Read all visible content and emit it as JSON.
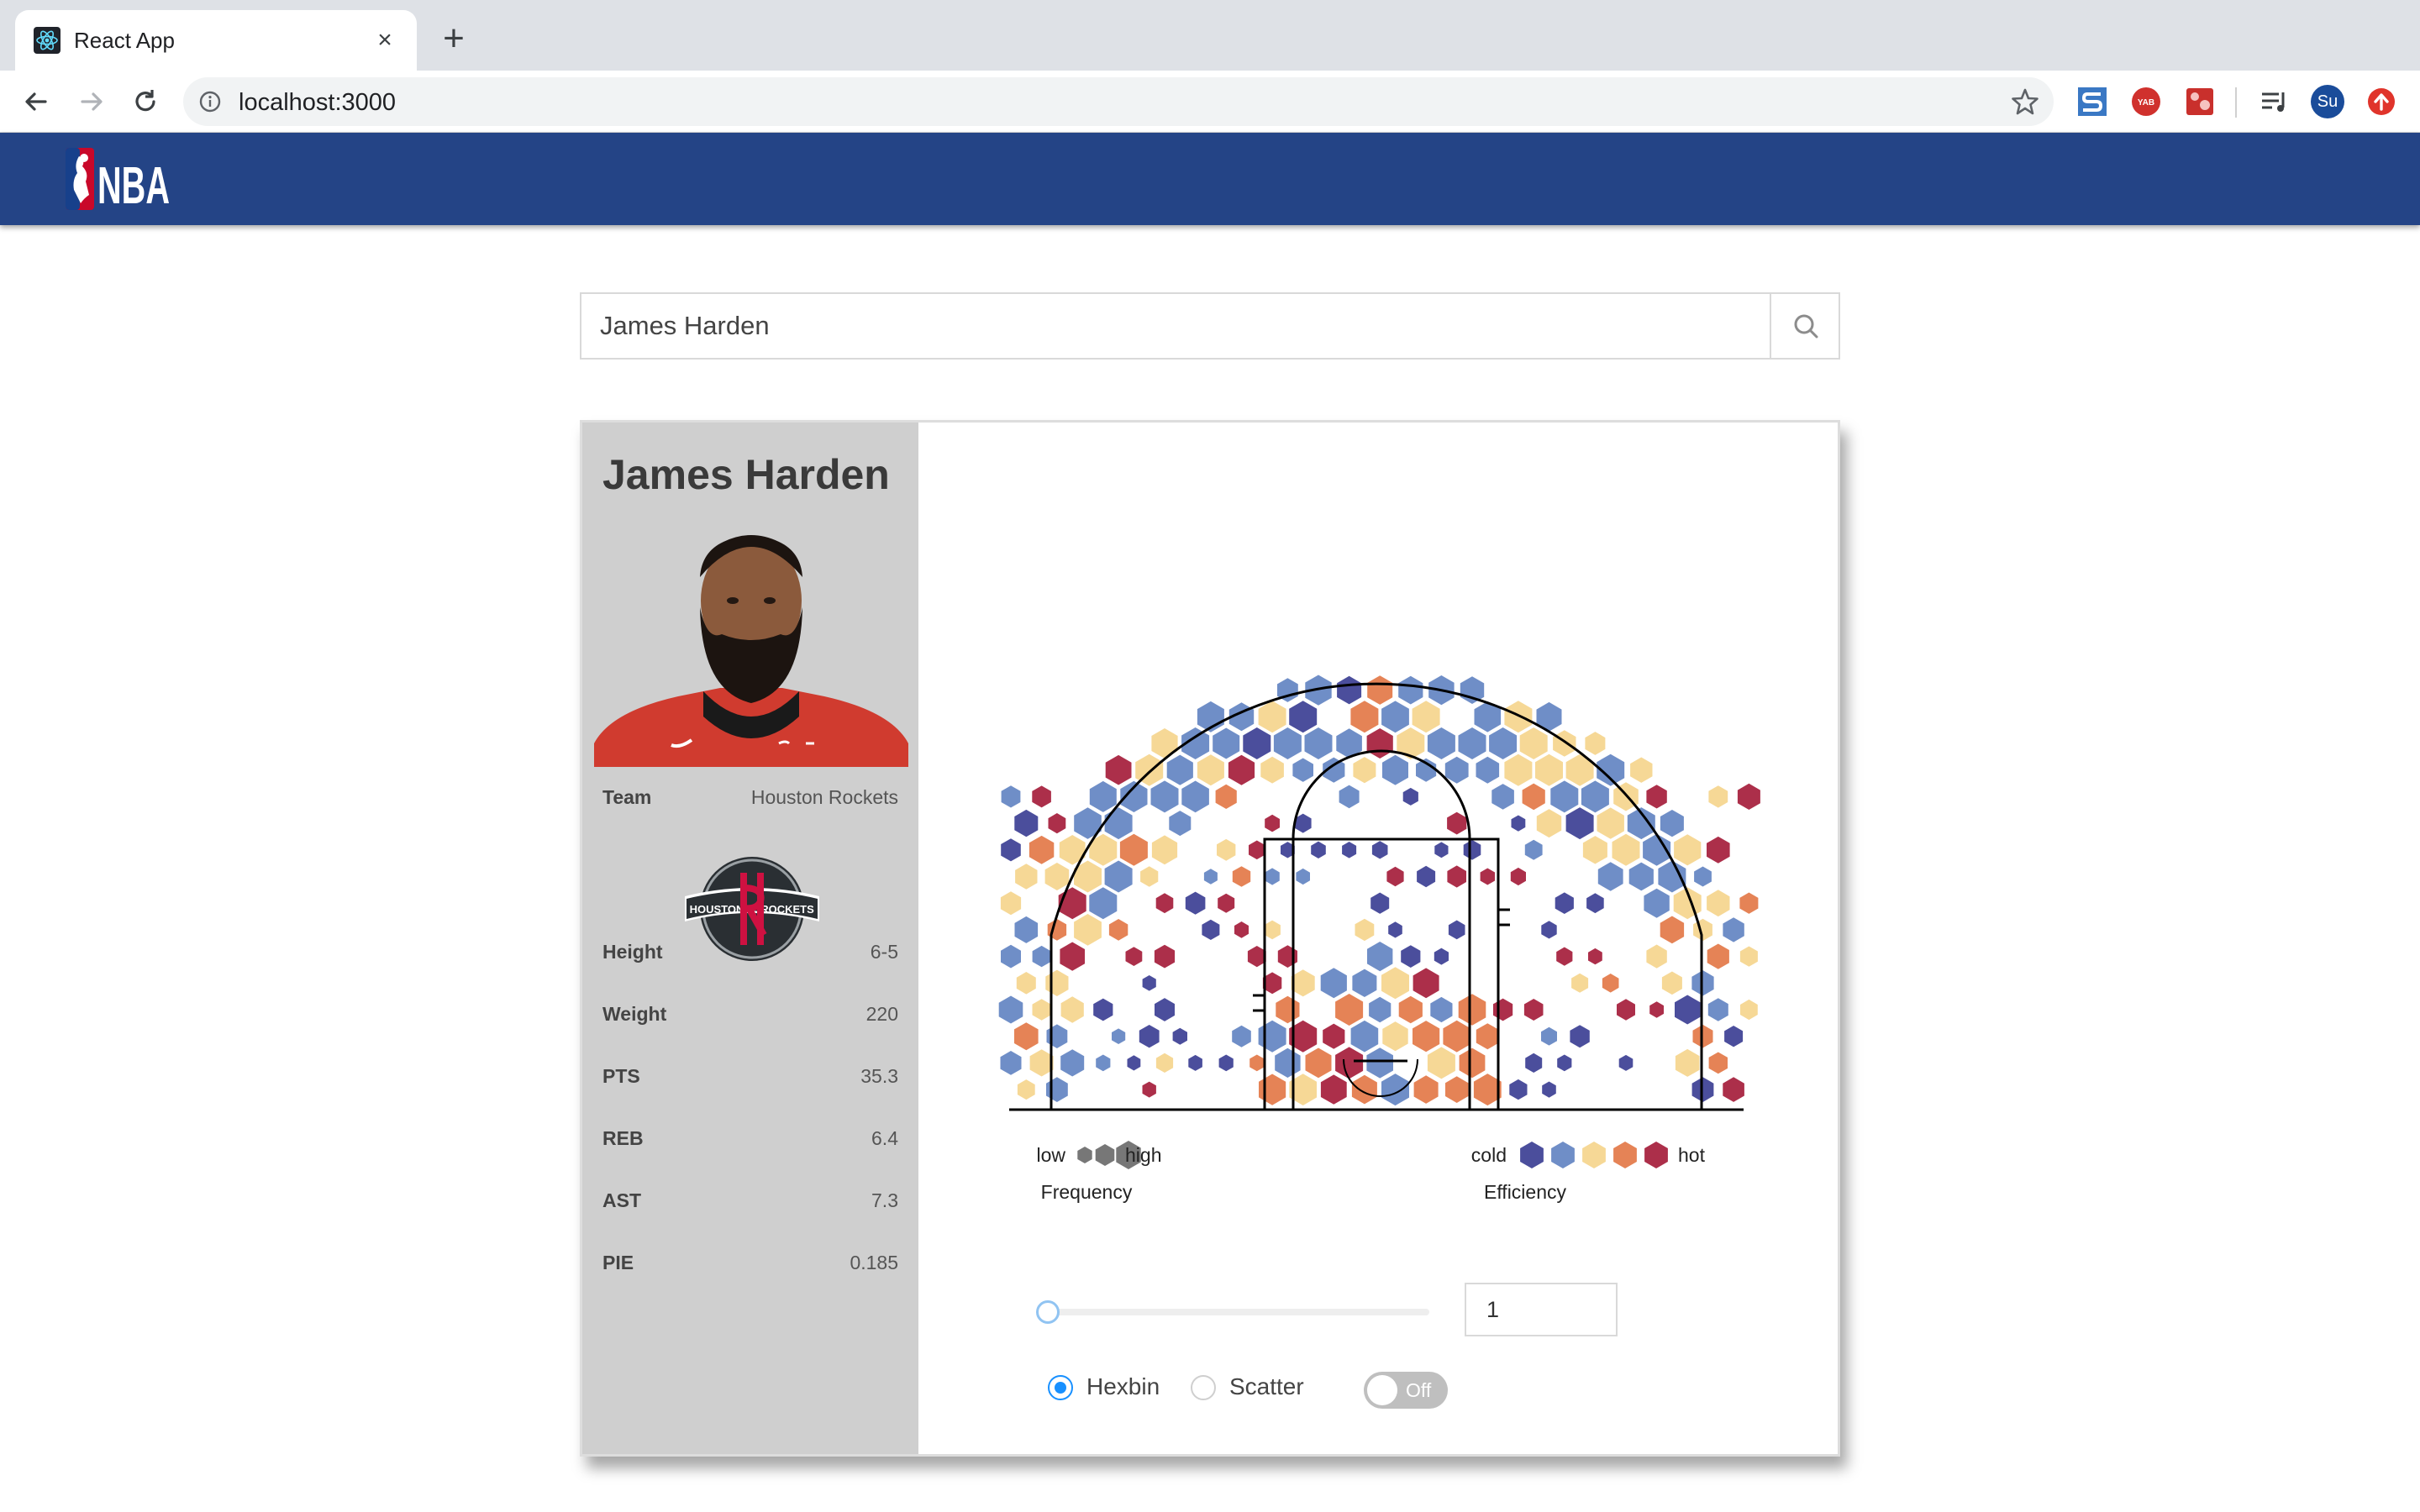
{
  "browser": {
    "tab_title": "React App",
    "tab_close": "×",
    "new_tab": "+",
    "url": "localhost:3000",
    "profile_initials": "Su",
    "ext_badge": "YAB"
  },
  "header": {
    "logo_text": "NBA"
  },
  "search": {
    "value": "James Harden"
  },
  "player": {
    "name": "James Harden",
    "team_label": "Team",
    "team": "Houston Rockets",
    "team_logo_text_left": "HOUSTON",
    "team_logo_text_right": "ROCKETS",
    "stats": [
      {
        "label": "Height",
        "value": "6-5"
      },
      {
        "label": "Weight",
        "value": "220"
      },
      {
        "label": "PTS",
        "value": "35.3"
      },
      {
        "label": "REB",
        "value": "6.4"
      },
      {
        "label": "AST",
        "value": "7.3"
      },
      {
        "label": "PIE",
        "value": "0.185"
      }
    ]
  },
  "legend": {
    "freq_low": "low",
    "freq_high": "high",
    "freq_title": "Frequency",
    "eff_cold": "cold",
    "eff_hot": "hot",
    "eff_title": "Efficiency",
    "eff_colors": [
      "#4b4e9c",
      "#6f8ec7",
      "#f6d896",
      "#e58356",
      "#ac2f4a"
    ],
    "freq_color": "#777777"
  },
  "controls": {
    "min_count_value": "1",
    "slider_value": 1,
    "chart_type_options": [
      "Hexbin",
      "Scatter"
    ],
    "chart_type_selected": "Hexbin",
    "display_toggle_label": "Off"
  }
}
